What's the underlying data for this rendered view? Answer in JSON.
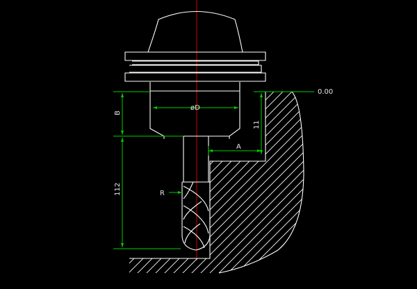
{
  "drawing": {
    "colors": {
      "background": "#000000",
      "geometry": "#ffffff",
      "dimension": "#00d000",
      "centerline": "#d00000",
      "text": "#e6e6e6"
    },
    "labels": {
      "diameter": "øD",
      "b_dim": "B",
      "dim_11": "11",
      "a_dim": "A",
      "datum": "0.00",
      "dim_112": "112",
      "radius": "R"
    }
  }
}
